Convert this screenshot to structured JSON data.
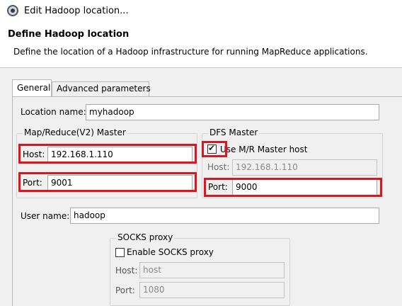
{
  "window": {
    "title": "Edit Hadoop location..."
  },
  "header": {
    "heading": "Define Hadoop location",
    "description": "Define the location of a Hadoop infrastructure for running MapReduce applications."
  },
  "tabs": [
    {
      "label": "General",
      "selected": true
    },
    {
      "label": "Advanced parameters",
      "selected": false
    }
  ],
  "general": {
    "location_name": {
      "label": "Location name:",
      "value": "myhadoop"
    },
    "mr_master": {
      "title": "Map/Reduce(V2) Master",
      "host_label": "Host:",
      "host_value": "192.168.1.110",
      "port_label": "Port:",
      "port_value": "9001"
    },
    "dfs_master": {
      "title": "DFS Master",
      "use_mr_label": "Use M/R Master host",
      "use_mr_checked": true,
      "host_label": "Host:",
      "host_value": "192.168.1.110",
      "port_label": "Port:",
      "port_value": "9000"
    },
    "user_name": {
      "label": "User name:",
      "value": "hadoop"
    },
    "socks": {
      "title": "SOCKS proxy",
      "enable_label": "Enable SOCKS proxy",
      "enable_checked": false,
      "host_label": "Host:",
      "host_value": "host",
      "port_label": "Port:",
      "port_value": "1080"
    }
  },
  "highlight_color": "#e0141c"
}
